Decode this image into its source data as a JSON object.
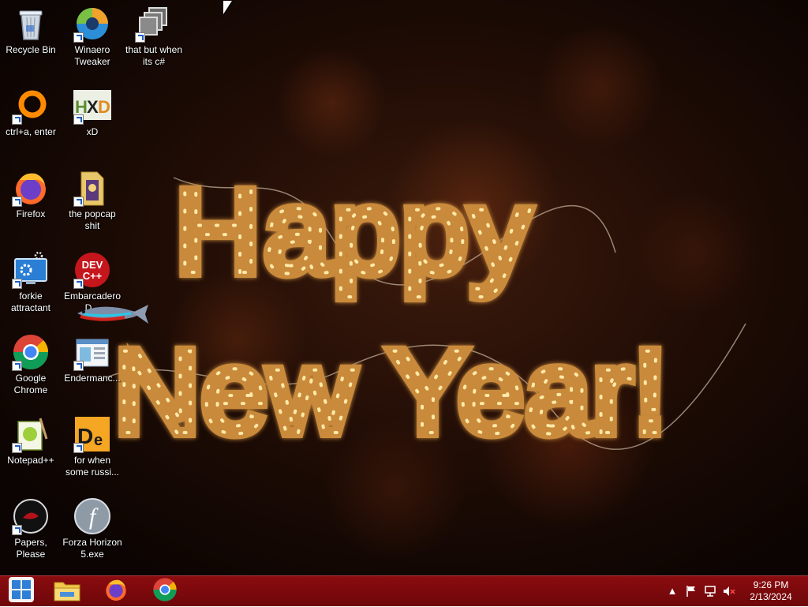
{
  "desktop": {
    "wallpaper_text": {
      "line1": "Happy",
      "line2": "New Year!"
    },
    "icons": [
      {
        "label": "Recycle Bin",
        "icon": "recycle-bin-icon",
        "shortcut": false
      },
      {
        "label": "Winaero Tweaker",
        "icon": "winaero-tweaker-icon",
        "shortcut": true
      },
      {
        "label": "that but when its c#",
        "icon": "stacked-windows-icon",
        "shortcut": true
      },
      {
        "label": "ctrl+a, enter",
        "icon": "orange-ring-icon",
        "shortcut": true
      },
      {
        "label": "xD",
        "icon": "hxd-icon",
        "shortcut": true
      },
      {
        "label": "Firefox",
        "icon": "firefox-icon",
        "shortcut": true
      },
      {
        "label": "the popcap shit",
        "icon": "folder-icon",
        "shortcut": true
      },
      {
        "label": "forkie attractant",
        "icon": "computer-settings-icon",
        "shortcut": true
      },
      {
        "label": "Embarcadero D...",
        "icon": "dev-cpp-icon",
        "shortcut": true
      },
      {
        "label": "Google Chrome",
        "icon": "chrome-icon",
        "shortcut": true
      },
      {
        "label": "Endermanc...",
        "icon": "window-app-icon",
        "shortcut": true
      },
      {
        "label": "Notepad++",
        "icon": "notepad-plus-plus-icon",
        "shortcut": true
      },
      {
        "label": "for when some russi...",
        "icon": "de-app-icon",
        "shortcut": true
      },
      {
        "label": "Papers, Please",
        "icon": "papers-please-icon",
        "shortcut": true
      },
      {
        "label": "Forza Horizon 5.exe",
        "icon": "flash-icon",
        "shortcut": false
      }
    ]
  },
  "taskbar": {
    "buttons": [
      {
        "name": "start-button",
        "icon": "windows-logo-icon"
      },
      {
        "name": "file-explorer-button",
        "icon": "folder-icon"
      },
      {
        "name": "firefox-button",
        "icon": "firefox-icon"
      },
      {
        "name": "chrome-button",
        "icon": "chrome-icon"
      }
    ],
    "tray": {
      "icons": [
        "show-hidden-icons-chevron",
        "flag-icon",
        "network-icon",
        "volume-muted-icon"
      ],
      "time": "9:26 PM",
      "date": "2/13/2024"
    }
  },
  "colors": {
    "taskbar": "#7d0a0d",
    "wallpaper_glow": "#f5c868",
    "label_text": "#ffffff"
  }
}
